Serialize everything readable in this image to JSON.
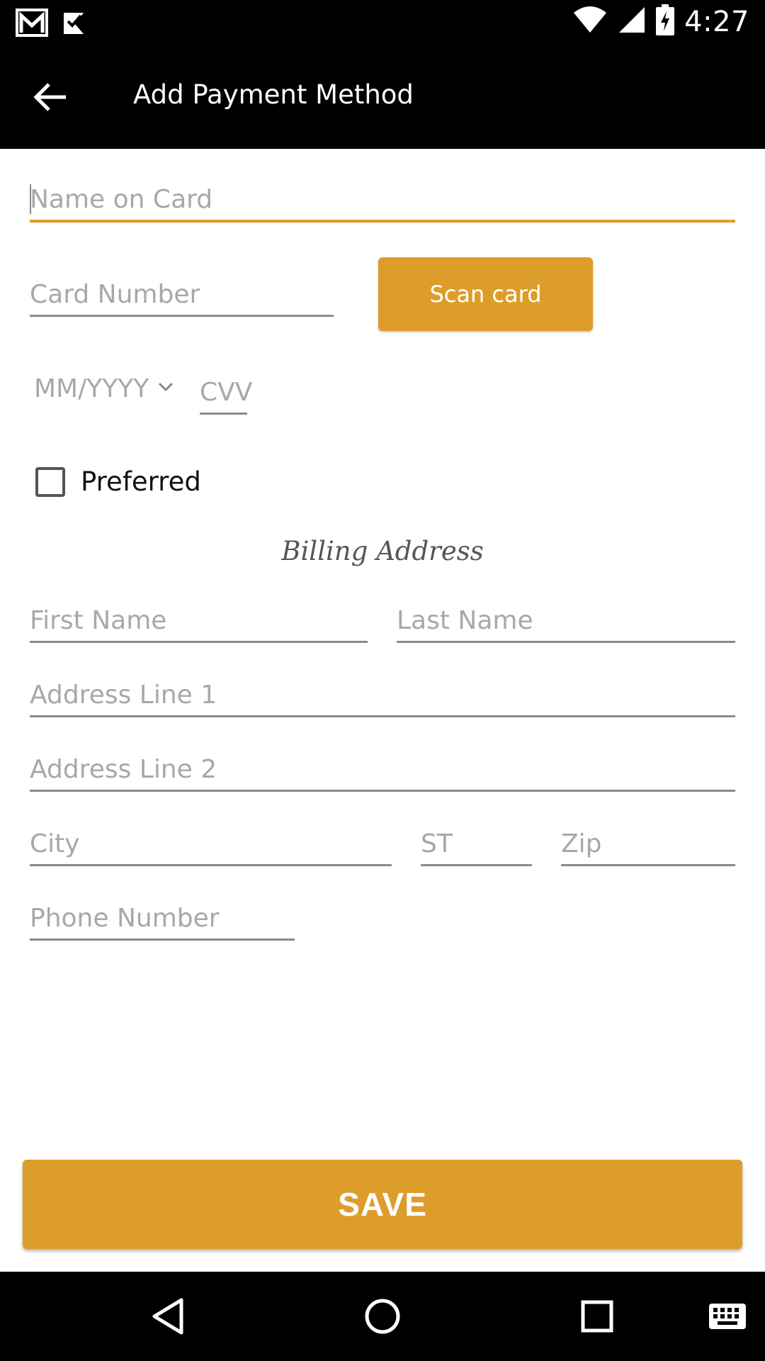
{
  "status_bar": {
    "time": "4:27",
    "icons": [
      "gmail-icon",
      "check-app-icon",
      "wifi-icon",
      "signal-icon",
      "battery-charging-icon"
    ]
  },
  "app_bar": {
    "title": "Add Payment Method",
    "back_icon": "arrow-back-icon"
  },
  "card_form": {
    "name_on_card_placeholder": "Name on Card",
    "card_number_placeholder": "Card Number",
    "scan_card_label": "Scan card",
    "expiry_placeholder": "MM/YYYY",
    "cvv_placeholder": "CVV",
    "preferred_label": "Preferred",
    "preferred_checked": false
  },
  "billing": {
    "title": "Billing Address",
    "first_name_placeholder": "First Name",
    "last_name_placeholder": "Last Name",
    "address1_placeholder": "Address Line 1",
    "address2_placeholder": "Address Line 2",
    "city_placeholder": "City",
    "state_placeholder": "ST",
    "zip_placeholder": "Zip",
    "phone_placeholder": "Phone Number"
  },
  "actions": {
    "save_label": "SAVE"
  },
  "nav_bar": {
    "icons": [
      "nav-back-icon",
      "nav-home-icon",
      "nav-recents-icon",
      "keyboard-icon"
    ]
  },
  "colors": {
    "accent": "#dd9d2a",
    "bar_background": "#000000",
    "placeholder": "#a8a8a8"
  }
}
